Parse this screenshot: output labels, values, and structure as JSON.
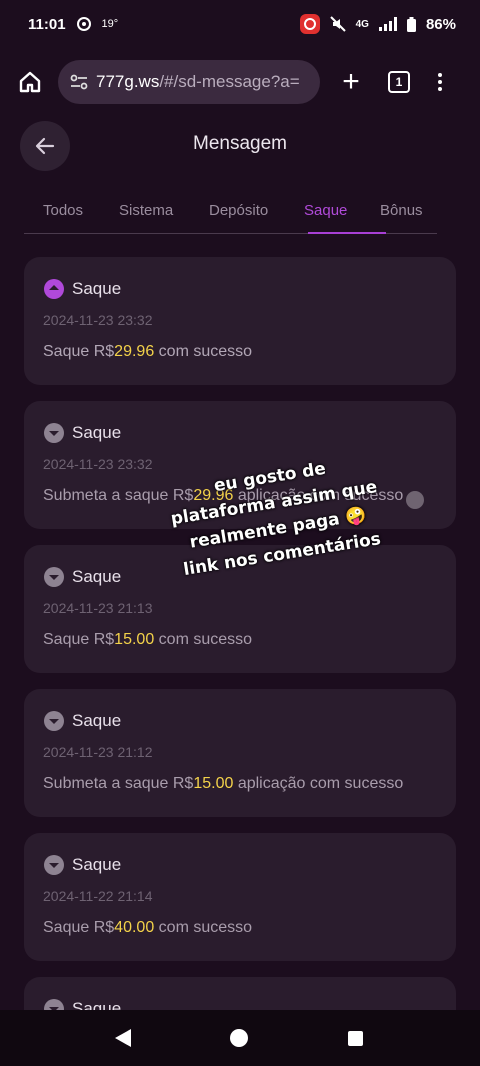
{
  "status_bar": {
    "time": "11:01",
    "temperature": "19°",
    "network": "4G",
    "battery": "86%"
  },
  "browser": {
    "url_host": "777g.ws",
    "url_rest": "/#/sd-message?a=",
    "tab_count": "1"
  },
  "header": {
    "title": "Mensagem"
  },
  "tabs": [
    {
      "label": "Todos"
    },
    {
      "label": "Sistema"
    },
    {
      "label": "Depósito"
    },
    {
      "label": "Saque",
      "active": true
    },
    {
      "label": "Bônus"
    }
  ],
  "messages": [
    {
      "title": "Saque",
      "date": "2024-11-23 23:32",
      "pre": "Saque R$",
      "amount": "29.96",
      "post": " com sucesso",
      "expanded": true
    },
    {
      "title": "Saque",
      "date": "2024-11-23 23:32",
      "pre": "Submeta a saque R$",
      "amount": "29.96",
      "post": " aplicação com sucesso",
      "expanded": false
    },
    {
      "title": "Saque",
      "date": "2024-11-23 21:13",
      "pre": "Saque R$",
      "amount": "15.00",
      "post": " com sucesso",
      "expanded": false
    },
    {
      "title": "Saque",
      "date": "2024-11-23 21:12",
      "pre": "Submeta a saque R$",
      "amount": "15.00",
      "post": " aplicação com sucesso",
      "expanded": false
    },
    {
      "title": "Saque",
      "date": "2024-11-22 21:14",
      "pre": "Saque R$",
      "amount": "40.00",
      "post": " com sucesso",
      "expanded": false
    },
    {
      "title": "Saque",
      "date": "",
      "pre": "",
      "amount": "",
      "post": "",
      "expanded": false
    }
  ],
  "overlay_caption": {
    "line1": "eu gosto de",
    "line2": "plataforma assim que",
    "line3": "realmente paga 🤪",
    "line4": "link nos comentários"
  },
  "colors": {
    "background": "#1c0d1e",
    "card": "#2a1c2d",
    "accent": "#b04ad8",
    "amount": "#f3d24a"
  }
}
